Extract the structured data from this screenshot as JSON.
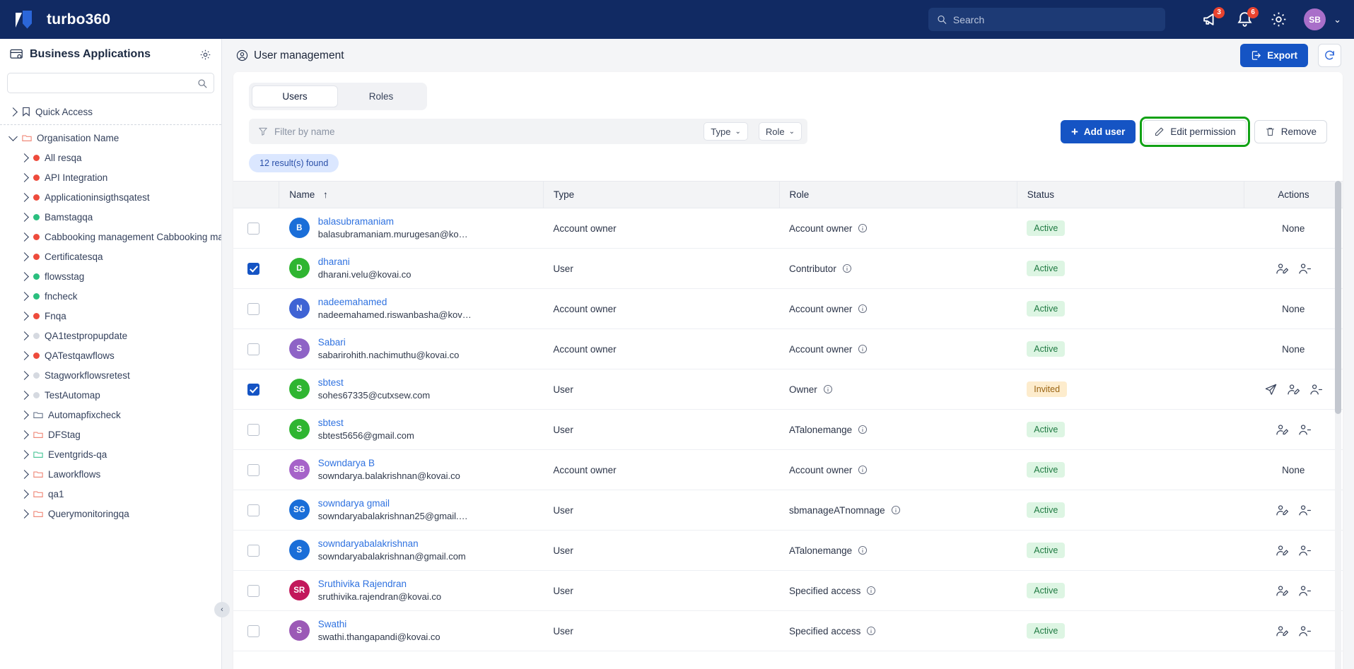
{
  "topbar": {
    "brand": "turbo360",
    "search_placeholder": "Search",
    "search_value": "",
    "announcements_badge": "3",
    "notifications_badge": "6",
    "avatar_initials": "SB",
    "icons": {
      "search": "search-icon",
      "announcement": "megaphone-icon",
      "notification": "bell-icon",
      "settings": "gear-icon",
      "chevron": "chevron-down-icon"
    }
  },
  "sidebar": {
    "title": "Business Applications",
    "gear_icon": "gear-icon",
    "search_placeholder": "",
    "search_value": "",
    "collapse_label": "‹",
    "quick_access": {
      "label": "Quick Access",
      "icon": "bookmark-icon",
      "expanded": false
    },
    "org": {
      "label": "Organisation Name",
      "icon": "folder-icon",
      "color": "#f08a7a",
      "expanded": true
    },
    "items": [
      {
        "label": "All resqa",
        "kind": "dot",
        "color": "#ee4b3c"
      },
      {
        "label": "API Integration",
        "kind": "dot",
        "color": "#ee4b3c"
      },
      {
        "label": "Applicationinsigthsqatest",
        "kind": "dot",
        "color": "#ee4b3c"
      },
      {
        "label": "Bamstagqa",
        "kind": "dot",
        "color": "#2bbf7f"
      },
      {
        "label": "Cabbooking management Cabbooking mana",
        "kind": "dot",
        "color": "#ee4b3c"
      },
      {
        "label": "Certificatesqa",
        "kind": "dot",
        "color": "#ee4b3c"
      },
      {
        "label": "flowsstag",
        "kind": "dot",
        "color": "#2bbf7f"
      },
      {
        "label": "fncheck",
        "kind": "dot",
        "color": "#2bbf7f"
      },
      {
        "label": "Fnqa",
        "kind": "dot",
        "color": "#ee4b3c"
      },
      {
        "label": "QA1testpropupdate",
        "kind": "dot",
        "color": "#d5d9e0"
      },
      {
        "label": "QATestqawflows",
        "kind": "dot",
        "color": "#ee4b3c"
      },
      {
        "label": "Stagworkflowsretest",
        "kind": "dot",
        "color": "#d5d9e0"
      },
      {
        "label": "TestAutomap",
        "kind": "dot",
        "color": "#d5d9e0"
      },
      {
        "label": "Automapfixcheck",
        "kind": "folder",
        "color": "#6f7b90"
      },
      {
        "label": "DFStag",
        "kind": "folder",
        "color": "#f08a7a"
      },
      {
        "label": "Eventgrids-qa",
        "kind": "folder",
        "color": "#4cc79a"
      },
      {
        "label": "Laworkflows",
        "kind": "folder",
        "color": "#f08a7a"
      },
      {
        "label": "qa1",
        "kind": "folder",
        "color": "#f08a7a"
      },
      {
        "label": "Querymonitoringqa",
        "kind": "folder",
        "color": "#f08a7a"
      }
    ]
  },
  "page": {
    "title": "User management",
    "title_icon": "user-circle-icon",
    "export_label": "Export",
    "export_icon": "export-icon",
    "refresh_icon": "refresh-icon"
  },
  "tabs": [
    {
      "label": "Users",
      "active": true
    },
    {
      "label": "Roles",
      "active": false
    }
  ],
  "toolbar": {
    "filter_placeholder": "Filter by name",
    "filter_value": "",
    "filter_icon": "filter-icon",
    "type_select": "Type",
    "role_select": "Role",
    "add_user_label": "Add user",
    "edit_permission_label": "Edit permission",
    "remove_label": "Remove",
    "highlight_color": "#11a215"
  },
  "result_chip": "12 result(s) found",
  "table": {
    "columns": [
      "",
      "Name",
      "Type",
      "Role",
      "Status",
      "Actions"
    ],
    "sort_column": "Name",
    "sort_icon": "arrow-up-icon",
    "rows": [
      {
        "checked": false,
        "initials": "B",
        "avatar_color": "#1a6ed8",
        "name": "balasubramaniam",
        "email": "balasubramaniam.murugesan@ko…",
        "type": "Account owner",
        "role": "Account owner",
        "status": "Active",
        "actions": "none"
      },
      {
        "checked": true,
        "initials": "D",
        "avatar_color": "#2fb531",
        "name": "dharani",
        "email": "dharani.velu@kovai.co",
        "type": "User",
        "role": "Contributor",
        "status": "Active",
        "actions": "edit-remove"
      },
      {
        "checked": false,
        "initials": "N",
        "avatar_color": "#3f63d4",
        "name": "nadeemahamed",
        "email": "nadeemahamed.riswanbasha@kov…",
        "type": "Account owner",
        "role": "Account owner",
        "status": "Active",
        "actions": "none"
      },
      {
        "checked": false,
        "initials": "S",
        "avatar_color": "#8e63c6",
        "name": "Sabari",
        "email": "sabarirohith.nachimuthu@kovai.co",
        "type": "Account owner",
        "role": "Account owner",
        "status": "Active",
        "actions": "none"
      },
      {
        "checked": true,
        "initials": "S",
        "avatar_color": "#2fb531",
        "name": "sbtest",
        "email": "sohes67335@cutxsew.com",
        "type": "User",
        "role": "Owner",
        "status": "Invited",
        "actions": "resend-edit-remove"
      },
      {
        "checked": false,
        "initials": "S",
        "avatar_color": "#2fb531",
        "name": "sbtest",
        "email": "sbtest5656@gmail.com",
        "type": "User",
        "role": "ATalonemange",
        "status": "Active",
        "actions": "edit-remove"
      },
      {
        "checked": false,
        "initials": "SB",
        "avatar_color": "#a663c9",
        "name": "Sowndarya B",
        "email": "sowndarya.balakrishnan@kovai.co",
        "type": "Account owner",
        "role": "Account owner",
        "status": "Active",
        "actions": "none"
      },
      {
        "checked": false,
        "initials": "SG",
        "avatar_color": "#1a6ed8",
        "name": "sowndarya gmail",
        "email": "sowndaryabalakrishnan25@gmail.…",
        "type": "User",
        "role": "sbmanageATnomnage",
        "status": "Active",
        "actions": "edit-remove"
      },
      {
        "checked": false,
        "initials": "S",
        "avatar_color": "#1a6ed8",
        "name": "sowndaryabalakrishnan",
        "email": "sowndaryabalakrishnan@gmail.com",
        "type": "User",
        "role": "ATalonemange",
        "status": "Active",
        "actions": "edit-remove"
      },
      {
        "checked": false,
        "initials": "SR",
        "avatar_color": "#c2185b",
        "name": "Sruthivika Rajendran",
        "email": "sruthivika.rajendran@kovai.co",
        "type": "User",
        "role": "Specified access",
        "status": "Active",
        "actions": "edit-remove"
      },
      {
        "checked": false,
        "initials": "S",
        "avatar_color": "#9b59b6",
        "name": "Swathi",
        "email": "swathi.thangapandi@kovai.co",
        "type": "User",
        "role": "Specified access",
        "status": "Active",
        "actions": "edit-remove"
      }
    ],
    "none_label": "None"
  }
}
